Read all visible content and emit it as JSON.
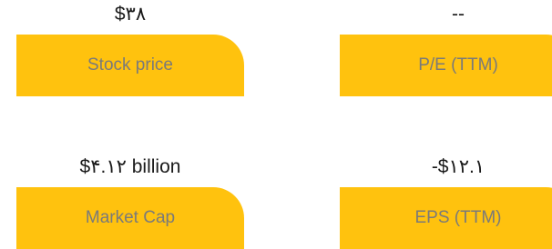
{
  "colors": {
    "card_bg": "#ffc20e",
    "label_text": "#7a7a7a",
    "value_text": "#1a1a1a"
  },
  "stats": {
    "stock_price": {
      "value": "$۳۸",
      "label": "Stock price"
    },
    "pe_ttm": {
      "value": "--",
      "label": "P/E (TTM)"
    },
    "market_cap": {
      "value": "$۴.۱۲ billion",
      "label": "Market Cap"
    },
    "eps_ttm": {
      "value": "-$۱۲.۱",
      "label": "EPS (TTM)"
    }
  }
}
